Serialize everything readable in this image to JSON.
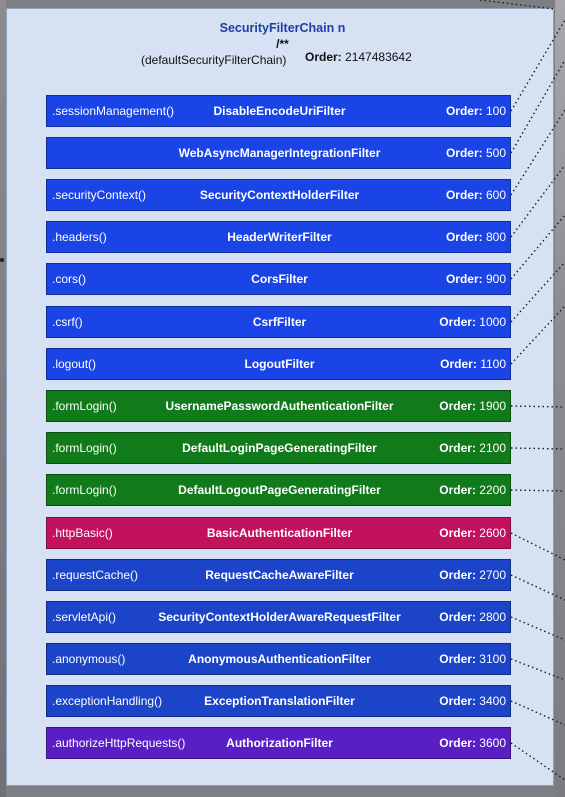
{
  "chain": {
    "title": "SecurityFilterChain n",
    "pattern": "/**",
    "name": "(defaultSecurityFilterChain)",
    "order_label": "Order:",
    "order_value": "2147483642"
  },
  "filters": [
    {
      "config": ".sessionManagement()",
      "name": "DisableEncodeUriFilter",
      "order_label": "Order:",
      "order": "100",
      "color": "#1a44e6"
    },
    {
      "config": "",
      "name": "WebAsyncManagerIntegrationFilter",
      "order_label": "Order:",
      "order": "500",
      "color": "#1a44e6"
    },
    {
      "config": ".securityContext()",
      "name": "SecurityContextHolderFilter",
      "order_label": "Order:",
      "order": "600",
      "color": "#1a44e6"
    },
    {
      "config": ".headers()",
      "name": "HeaderWriterFilter",
      "order_label": "Order:",
      "order": "800",
      "color": "#1a44e6"
    },
    {
      "config": ".cors()",
      "name": "CorsFilter",
      "order_label": "Order:",
      "order": "900",
      "color": "#1a44e6"
    },
    {
      "config": ".csrf()",
      "name": "CsrfFilter",
      "order_label": "Order:",
      "order": "1000",
      "color": "#1a44e6"
    },
    {
      "config": ".logout()",
      "name": "LogoutFilter",
      "order_label": "Order:",
      "order": "1100",
      "color": "#1a44e6"
    },
    {
      "config": ".formLogin()",
      "name": "UsernamePasswordAuthenticationFilter",
      "order_label": "Order:",
      "order": "1900",
      "color": "#117a1a"
    },
    {
      "config": ".formLogin()",
      "name": "DefaultLoginPageGeneratingFilter",
      "order_label": "Order:",
      "order": "2100",
      "color": "#117a1a"
    },
    {
      "config": ".formLogin()",
      "name": "DefaultLogoutPageGeneratingFilter",
      "order_label": "Order:",
      "order": "2200",
      "color": "#117a1a"
    },
    {
      "config": ".httpBasic()",
      "name": "BasicAuthenticationFilter",
      "order_label": "Order:",
      "order": "2600",
      "color": "#c2125e"
    },
    {
      "config": ".requestCache()",
      "name": "RequestCacheAwareFilter",
      "order_label": "Order:",
      "order": "2700",
      "color": "#1c44c8"
    },
    {
      "config": ".servletApi()",
      "name": "SecurityContextHolderAwareRequestFilter",
      "order_label": "Order:",
      "order": "2800",
      "color": "#1c44c8"
    },
    {
      "config": ".anonymous()",
      "name": "AnonymousAuthenticationFilter",
      "order_label": "Order:",
      "order": "3100",
      "color": "#1c44c8"
    },
    {
      "config": ".exceptionHandling()",
      "name": "ExceptionTranslationFilter",
      "order_label": "Order:",
      "order": "3400",
      "color": "#1c44c8"
    },
    {
      "config": ".authorizeHttpRequests()",
      "name": "AuthorizationFilter",
      "order_label": "Order:",
      "order": "3600",
      "color": "#5a1fc4"
    }
  ]
}
